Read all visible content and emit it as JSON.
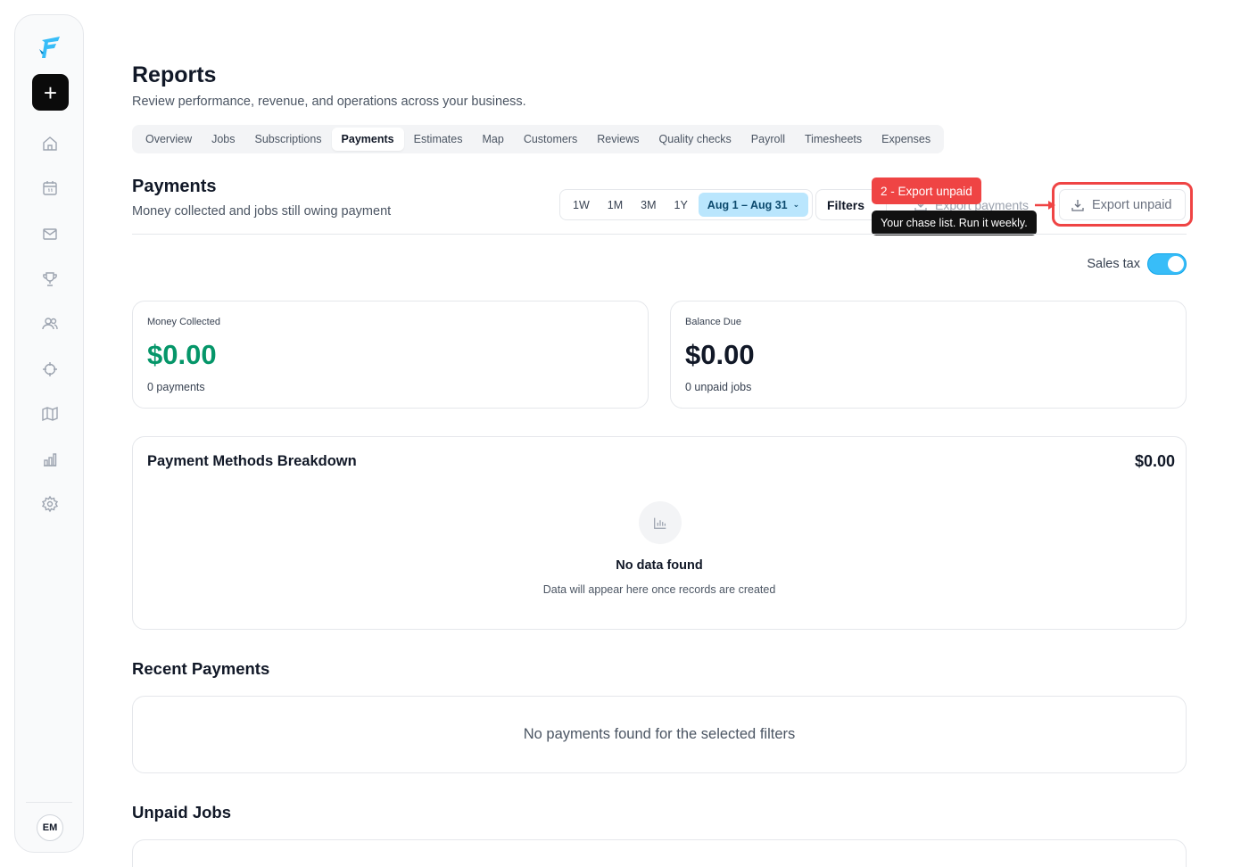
{
  "sidebar": {
    "new_label": "+",
    "avatar_initials": "EM",
    "items": [
      "home",
      "calendar",
      "mail",
      "trophy",
      "users",
      "target",
      "map",
      "reports",
      "settings"
    ]
  },
  "header": {
    "title": "Reports",
    "subtitle": "Review performance, revenue, and operations across your business."
  },
  "tabs": [
    {
      "label": "Overview"
    },
    {
      "label": "Jobs"
    },
    {
      "label": "Subscriptions"
    },
    {
      "label": "Payments",
      "active": true
    },
    {
      "label": "Estimates"
    },
    {
      "label": "Map"
    },
    {
      "label": "Customers"
    },
    {
      "label": "Reviews"
    },
    {
      "label": "Quality checks"
    },
    {
      "label": "Payroll"
    },
    {
      "label": "Timesheets"
    },
    {
      "label": "Expenses"
    }
  ],
  "section": {
    "title": "Payments",
    "subtitle": "Money collected and jobs still owing payment"
  },
  "toolbar": {
    "ranges": [
      "1W",
      "1M",
      "3M",
      "1Y"
    ],
    "date_range": "Aug 1 – Aug 31",
    "filters_label": "Filters",
    "export_payments_label": "Export payments",
    "export_unpaid_label": "Export unpaid"
  },
  "callout": {
    "badge": "2 - Export unpaid",
    "tooltip": "Your chase list. Run it weekly.",
    "color": "#ef4444"
  },
  "sales_tax": {
    "label": "Sales tax",
    "enabled": true
  },
  "cards": {
    "collected": {
      "label": "Money Collected",
      "value": "$0.00",
      "sub": "0 payments",
      "color": "#059669"
    },
    "balance": {
      "label": "Balance Due",
      "value": "$0.00",
      "sub": "0 unpaid jobs",
      "color": "#111827"
    }
  },
  "payment_methods": {
    "title": "Payment Methods Breakdown",
    "total": "$0.00",
    "empty_title": "No data found",
    "empty_sub": "Data will appear here once records are created"
  },
  "recent_payments": {
    "title": "Recent Payments",
    "empty": "No payments found for the selected filters"
  },
  "unpaid_jobs": {
    "title": "Unpaid Jobs"
  },
  "colors": {
    "accent": "#38bdf8",
    "range_active_bg": "#bae6fd",
    "success": "#059669",
    "danger": "#ef4444"
  }
}
